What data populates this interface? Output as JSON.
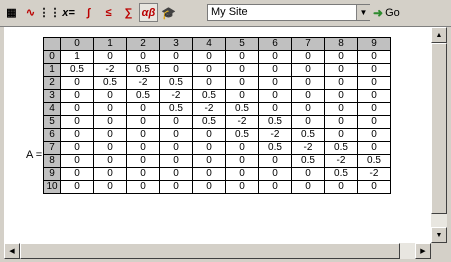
{
  "toolbar": {
    "buttons": [
      {
        "name": "calculator-icon",
        "glyph": "▦"
      },
      {
        "name": "graph-icon",
        "glyph": "∿"
      },
      {
        "name": "matrix-icon",
        "glyph": "⋮⋮"
      },
      {
        "name": "evaluate-icon",
        "glyph": "x="
      },
      {
        "name": "calculus-icon",
        "glyph": "∫"
      },
      {
        "name": "boolean-icon",
        "glyph": "≤"
      },
      {
        "name": "programming-icon",
        "glyph": "∑"
      },
      {
        "name": "greek-icon",
        "glyph": "αβ"
      },
      {
        "name": "symbolic-icon",
        "glyph": "🎓"
      }
    ],
    "address_value": "My Site",
    "go_label": "Go"
  },
  "matrix": {
    "label": "A =",
    "column_headers": [
      "0",
      "1",
      "2",
      "3",
      "4",
      "5",
      "6",
      "7",
      "8",
      "9"
    ],
    "rows": [
      {
        "index": "0",
        "values": [
          "1",
          "0",
          "0",
          "0",
          "0",
          "0",
          "0",
          "0",
          "0",
          "0"
        ]
      },
      {
        "index": "1",
        "values": [
          "0.5",
          "-2",
          "0.5",
          "0",
          "0",
          "0",
          "0",
          "0",
          "0",
          "0"
        ]
      },
      {
        "index": "2",
        "values": [
          "0",
          "0.5",
          "-2",
          "0.5",
          "0",
          "0",
          "0",
          "0",
          "0",
          "0"
        ]
      },
      {
        "index": "3",
        "values": [
          "0",
          "0",
          "0.5",
          "-2",
          "0.5",
          "0",
          "0",
          "0",
          "0",
          "0"
        ]
      },
      {
        "index": "4",
        "values": [
          "0",
          "0",
          "0",
          "0.5",
          "-2",
          "0.5",
          "0",
          "0",
          "0",
          "0"
        ]
      },
      {
        "index": "5",
        "values": [
          "0",
          "0",
          "0",
          "0",
          "0.5",
          "-2",
          "0.5",
          "0",
          "0",
          "0"
        ]
      },
      {
        "index": "6",
        "values": [
          "0",
          "0",
          "0",
          "0",
          "0",
          "0.5",
          "-2",
          "0.5",
          "0",
          "0"
        ]
      },
      {
        "index": "7",
        "values": [
          "0",
          "0",
          "0",
          "0",
          "0",
          "0",
          "0.5",
          "-2",
          "0.5",
          "0"
        ]
      },
      {
        "index": "8",
        "values": [
          "0",
          "0",
          "0",
          "0",
          "0",
          "0",
          "0",
          "0.5",
          "-2",
          "0.5"
        ]
      },
      {
        "index": "9",
        "values": [
          "0",
          "0",
          "0",
          "0",
          "0",
          "0",
          "0",
          "0",
          "0.5",
          "-2"
        ]
      },
      {
        "index": "10",
        "values": [
          "0",
          "0",
          "0",
          "0",
          "0",
          "0",
          "0",
          "0",
          "0",
          "0"
        ]
      }
    ]
  }
}
